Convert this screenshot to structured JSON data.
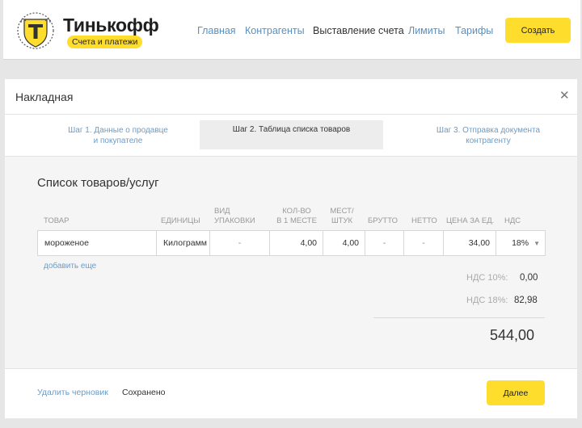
{
  "header": {
    "brand_name": "Тинькофф",
    "brand_subtitle": "Счета и платежи",
    "nav": [
      "Главная",
      "Контрагенты",
      "Выставление счета",
      "Лимиты",
      "Тарифы"
    ],
    "active_nav": "Выставление счета",
    "create_label": "Создать"
  },
  "panel": {
    "title": "Накладная",
    "steps": [
      {
        "line1": "Шаг 1. Данные о продавце",
        "line2": "и покупателе"
      },
      {
        "line1": "Шаг 2. Таблица списка товаров",
        "line2": ""
      },
      {
        "line1": "Шаг 3. Отправка документа",
        "line2": "контрагенту"
      }
    ],
    "active_step": 2,
    "section_title": "Список товаров/услуг",
    "columns": [
      {
        "line1": "товар",
        "line2": ""
      },
      {
        "line1": "единицы",
        "line2": ""
      },
      {
        "line1": "вид",
        "line2": "упаковки"
      },
      {
        "line1": "кол-во",
        "line2": "в 1 месте"
      },
      {
        "line1": "мест/",
        "line2": "штук"
      },
      {
        "line1": "брутто",
        "line2": ""
      },
      {
        "line1": "нетто",
        "line2": ""
      },
      {
        "line1": "цена за ед.",
        "line2": ""
      },
      {
        "line1": "ндс",
        "line2": ""
      }
    ],
    "rows": [
      {
        "name": "мороженое",
        "unit": "Килограмм",
        "package": "-",
        "qty_per_place": "4,00",
        "places": "4,00",
        "gross": "-",
        "net": "-",
        "price": "34,00",
        "vat": "18%"
      }
    ],
    "add_more": "добавить еще",
    "vat10_label": "НДС 10%:",
    "vat10_value": "0,00",
    "vat18_label": "НДС 18%:",
    "vat18_value": "82,98",
    "total": "544,00",
    "delete_draft": "Удалить черновик",
    "saved": "Сохранено",
    "next_label": "Далее"
  },
  "colors": {
    "accent": "#ffdd2d",
    "link": "#6d9bc4",
    "background": "#e6e6e6"
  },
  "icons": {
    "logo": "tinkoff-shield-logo",
    "close": "close-icon",
    "vat_dropdown": "triangle-down-icon"
  }
}
